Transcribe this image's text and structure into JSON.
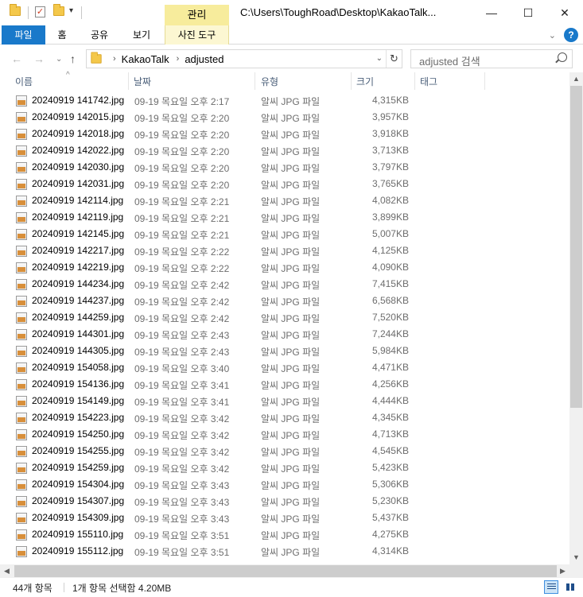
{
  "window": {
    "context_tab": "관리",
    "title": "C:\\Users\\ToughRoad\\Desktop\\KakaoTalk...",
    "minimize_glyph": "—",
    "maximize_glyph": "☐",
    "close_glyph": "✕"
  },
  "ribbon": {
    "tabs": [
      "파일",
      "홈",
      "공유",
      "보기",
      "사진 도구"
    ],
    "expand_glyph": "⌄",
    "help_glyph": "?"
  },
  "nav": {
    "back_glyph": "←",
    "forward_glyph": "→",
    "recent_glyph": "⌄",
    "up_glyph": "↑",
    "breadcrumb": [
      "KakaoTalk",
      "adjusted"
    ],
    "crumb_sep_glyph": "›",
    "refresh_glyph": "↻",
    "dropdown_glyph": "⌄",
    "search_placeholder": "adjusted 검색"
  },
  "columns": [
    "이름",
    "날짜",
    "유형",
    "크기",
    "태그"
  ],
  "files": [
    {
      "name": "20240919 141742.jpg",
      "date": "09-19 목요일 오후 2:17",
      "type": "알씨 JPG 파일",
      "size": "4,315KB"
    },
    {
      "name": "20240919 142015.jpg",
      "date": "09-19 목요일 오후 2:20",
      "type": "알씨 JPG 파일",
      "size": "3,957KB"
    },
    {
      "name": "20240919 142018.jpg",
      "date": "09-19 목요일 오후 2:20",
      "type": "알씨 JPG 파일",
      "size": "3,918KB"
    },
    {
      "name": "20240919 142022.jpg",
      "date": "09-19 목요일 오후 2:20",
      "type": "알씨 JPG 파일",
      "size": "3,713KB"
    },
    {
      "name": "20240919 142030.jpg",
      "date": "09-19 목요일 오후 2:20",
      "type": "알씨 JPG 파일",
      "size": "3,797KB"
    },
    {
      "name": "20240919 142031.jpg",
      "date": "09-19 목요일 오후 2:20",
      "type": "알씨 JPG 파일",
      "size": "3,765KB"
    },
    {
      "name": "20240919 142114.jpg",
      "date": "09-19 목요일 오후 2:21",
      "type": "알씨 JPG 파일",
      "size": "4,082KB"
    },
    {
      "name": "20240919 142119.jpg",
      "date": "09-19 목요일 오후 2:21",
      "type": "알씨 JPG 파일",
      "size": "3,899KB"
    },
    {
      "name": "20240919 142145.jpg",
      "date": "09-19 목요일 오후 2:21",
      "type": "알씨 JPG 파일",
      "size": "5,007KB"
    },
    {
      "name": "20240919 142217.jpg",
      "date": "09-19 목요일 오후 2:22",
      "type": "알씨 JPG 파일",
      "size": "4,125KB"
    },
    {
      "name": "20240919 142219.jpg",
      "date": "09-19 목요일 오후 2:22",
      "type": "알씨 JPG 파일",
      "size": "4,090KB"
    },
    {
      "name": "20240919 144234.jpg",
      "date": "09-19 목요일 오후 2:42",
      "type": "알씨 JPG 파일",
      "size": "7,415KB"
    },
    {
      "name": "20240919 144237.jpg",
      "date": "09-19 목요일 오후 2:42",
      "type": "알씨 JPG 파일",
      "size": "6,568KB"
    },
    {
      "name": "20240919 144259.jpg",
      "date": "09-19 목요일 오후 2:42",
      "type": "알씨 JPG 파일",
      "size": "7,520KB"
    },
    {
      "name": "20240919 144301.jpg",
      "date": "09-19 목요일 오후 2:43",
      "type": "알씨 JPG 파일",
      "size": "7,244KB"
    },
    {
      "name": "20240919 144305.jpg",
      "date": "09-19 목요일 오후 2:43",
      "type": "알씨 JPG 파일",
      "size": "5,984KB"
    },
    {
      "name": "20240919 154058.jpg",
      "date": "09-19 목요일 오후 3:40",
      "type": "알씨 JPG 파일",
      "size": "4,471KB"
    },
    {
      "name": "20240919 154136.jpg",
      "date": "09-19 목요일 오후 3:41",
      "type": "알씨 JPG 파일",
      "size": "4,256KB"
    },
    {
      "name": "20240919 154149.jpg",
      "date": "09-19 목요일 오후 3:41",
      "type": "알씨 JPG 파일",
      "size": "4,444KB"
    },
    {
      "name": "20240919 154223.jpg",
      "date": "09-19 목요일 오후 3:42",
      "type": "알씨 JPG 파일",
      "size": "4,345KB"
    },
    {
      "name": "20240919 154250.jpg",
      "date": "09-19 목요일 오후 3:42",
      "type": "알씨 JPG 파일",
      "size": "4,713KB"
    },
    {
      "name": "20240919 154255.jpg",
      "date": "09-19 목요일 오후 3:42",
      "type": "알씨 JPG 파일",
      "size": "4,545KB"
    },
    {
      "name": "20240919 154259.jpg",
      "date": "09-19 목요일 오후 3:42",
      "type": "알씨 JPG 파일",
      "size": "5,423KB"
    },
    {
      "name": "20240919 154304.jpg",
      "date": "09-19 목요일 오후 3:43",
      "type": "알씨 JPG 파일",
      "size": "5,306KB"
    },
    {
      "name": "20240919 154307.jpg",
      "date": "09-19 목요일 오후 3:43",
      "type": "알씨 JPG 파일",
      "size": "5,230KB"
    },
    {
      "name": "20240919 154309.jpg",
      "date": "09-19 목요일 오후 3:43",
      "type": "알씨 JPG 파일",
      "size": "5,437KB"
    },
    {
      "name": "20240919 155110.jpg",
      "date": "09-19 목요일 오후 3:51",
      "type": "알씨 JPG 파일",
      "size": "4,275KB"
    },
    {
      "name": "20240919 155112.jpg",
      "date": "09-19 목요일 오후 3:51",
      "type": "알씨 JPG 파일",
      "size": "4,314KB"
    }
  ],
  "status": {
    "item_count": "44개 항목",
    "selection": "1개 항목 선택함 4.20MB"
  },
  "scroll": {
    "up_glyph": "▲",
    "down_glyph": "▼",
    "left_glyph": "◀",
    "right_glyph": "▶"
  },
  "colors": {
    "file_tab": "#1979ca",
    "context_tab": "#f7ec9c",
    "header_text": "#4c607a"
  }
}
